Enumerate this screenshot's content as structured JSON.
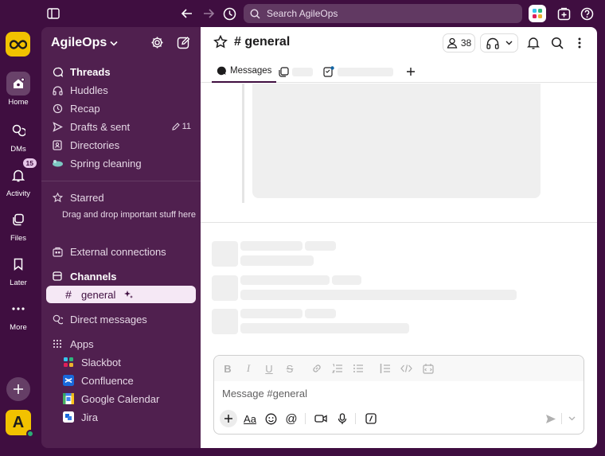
{
  "search": {
    "placeholder": "Search AgileOps"
  },
  "rail": {
    "workspace_logo": "infinity-logo",
    "items": [
      {
        "label": "Home"
      },
      {
        "label": "DMs"
      },
      {
        "label": "Activity",
        "badge": "15"
      },
      {
        "label": "Files"
      },
      {
        "label": "Later"
      },
      {
        "label": "More"
      }
    ],
    "avatar_letter": "A"
  },
  "sidebar": {
    "workspace_name": "AgileOps",
    "items": [
      {
        "label": "Threads"
      },
      {
        "label": "Huddles"
      },
      {
        "label": "Recap"
      },
      {
        "label": "Drafts & sent",
        "count": "11"
      },
      {
        "label": "Directories"
      },
      {
        "label": "Spring cleaning"
      }
    ],
    "starred": {
      "label": "Starred",
      "hint": "Drag and drop important stuff here"
    },
    "external": "External connections",
    "channels_header": "Channels",
    "channels": [
      {
        "name": "general"
      }
    ],
    "direct_messages": "Direct messages",
    "apps_header": "Apps",
    "apps": [
      {
        "name": "Slackbot"
      },
      {
        "name": "Confluence"
      },
      {
        "name": "Google Calendar"
      },
      {
        "name": "Jira"
      }
    ]
  },
  "channel": {
    "title": "# general",
    "member_count": "38",
    "tabs": [
      {
        "label": "Messages"
      }
    ]
  },
  "composer": {
    "placeholder": "Message #general"
  },
  "colors": {
    "aubergine": "#3f0e40",
    "sidebar": "#50204f",
    "accent": "#f2c200"
  }
}
